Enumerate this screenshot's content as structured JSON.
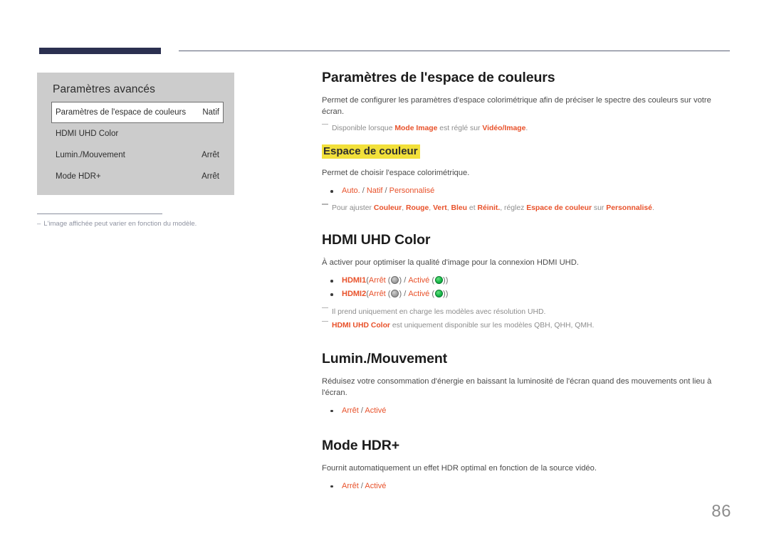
{
  "page": {
    "number": "86"
  },
  "osd": {
    "title": "Paramètres avancés",
    "rows": [
      {
        "label": "Paramètres de l'espace de couleurs",
        "value": "Natif",
        "selected": true
      },
      {
        "label": "HDMI UHD Color",
        "value": "",
        "selected": false
      },
      {
        "label": "Lumin./Mouvement",
        "value": "Arrêt",
        "selected": false
      },
      {
        "label": "Mode HDR+",
        "value": "Arrêt",
        "selected": false
      }
    ],
    "footnote": {
      "dash": "–",
      "text": "L'image affichée peut varier en fonction du modèle."
    }
  },
  "content": {
    "color_space": {
      "title": "Paramètres de l'espace de couleurs",
      "desc": "Permet de configurer les paramètres d'espace colorimétrique afin de préciser le spectre des couleurs sur votre écran.",
      "note_1": {
        "lead": "Disponible lorsque ",
        "term_1": "Mode Image",
        "mid": " est réglé sur ",
        "term_2": "Vidéo/Image",
        "tail": "."
      },
      "sub_title": "Espace de couleur",
      "sub_desc": "Permet de choisir l'espace colorimétrique.",
      "options": [
        "Auto.",
        "Natif",
        "Personnalisé"
      ],
      "options_separator": "/",
      "note_2": {
        "lead": "Pour ajuster ",
        "t1": "Couleur",
        "s1": ", ",
        "t2": "Rouge",
        "s2": ", ",
        "t3": "Vert",
        "s3": ", ",
        "t4": "Bleu",
        "s4": " et ",
        "t5": "Réinit.",
        "s5": ", réglez ",
        "t6": "Espace de couleur",
        "s6": " sur ",
        "t7": "Personnalisé",
        "tail": "."
      }
    },
    "hdmi_uhd": {
      "title": "HDMI UHD Color",
      "desc": "À activer pour optimiser la qualité d'image pour la connexion HDMI UHD.",
      "items": [
        {
          "name": "HDMI1",
          "open_paren": "(",
          "off_label": "Arrêt",
          "off_state": "off",
          "separator": "/",
          "on_label": "Activé",
          "on_state": "on",
          "close_paren": ")"
        },
        {
          "name": "HDMI2",
          "open_paren": "(",
          "off_label": "Arrêt",
          "off_state": "off",
          "separator": "/",
          "on_label": "Activé",
          "on_state": "on",
          "close_paren": ")"
        }
      ],
      "note_1": "Il prend uniquement en charge les modèles avec résolution UHD.",
      "note_2": {
        "term": "HDMI UHD Color",
        "tail": " est uniquement disponible sur les modèles QBH, QHH, QMH."
      }
    },
    "lumin_mouvement": {
      "title": "Lumin./Mouvement",
      "desc": "Réduisez votre consommation d'énergie en baissant la luminosité de l'écran quand des mouvements ont lieu à l'écran.",
      "options": [
        "Arrêt",
        "Activé"
      ],
      "options_separator": "/"
    },
    "mode_hdr_plus": {
      "title": "Mode HDR+",
      "desc": "Fournit automatiquement un effet HDR optimal en fonction de la source vidéo.",
      "options": [
        "Arrêt",
        "Activé"
      ],
      "options_separator": "/"
    }
  },
  "colors": {
    "accent_red": "#e8512a",
    "header_navy": "#2b3050",
    "highlight_yellow": "#f2e03a",
    "osd_panel_bg": "#cccccc",
    "toggle_on_green": "#18b84a",
    "toggle_off_gray": "#a6a6a6"
  }
}
